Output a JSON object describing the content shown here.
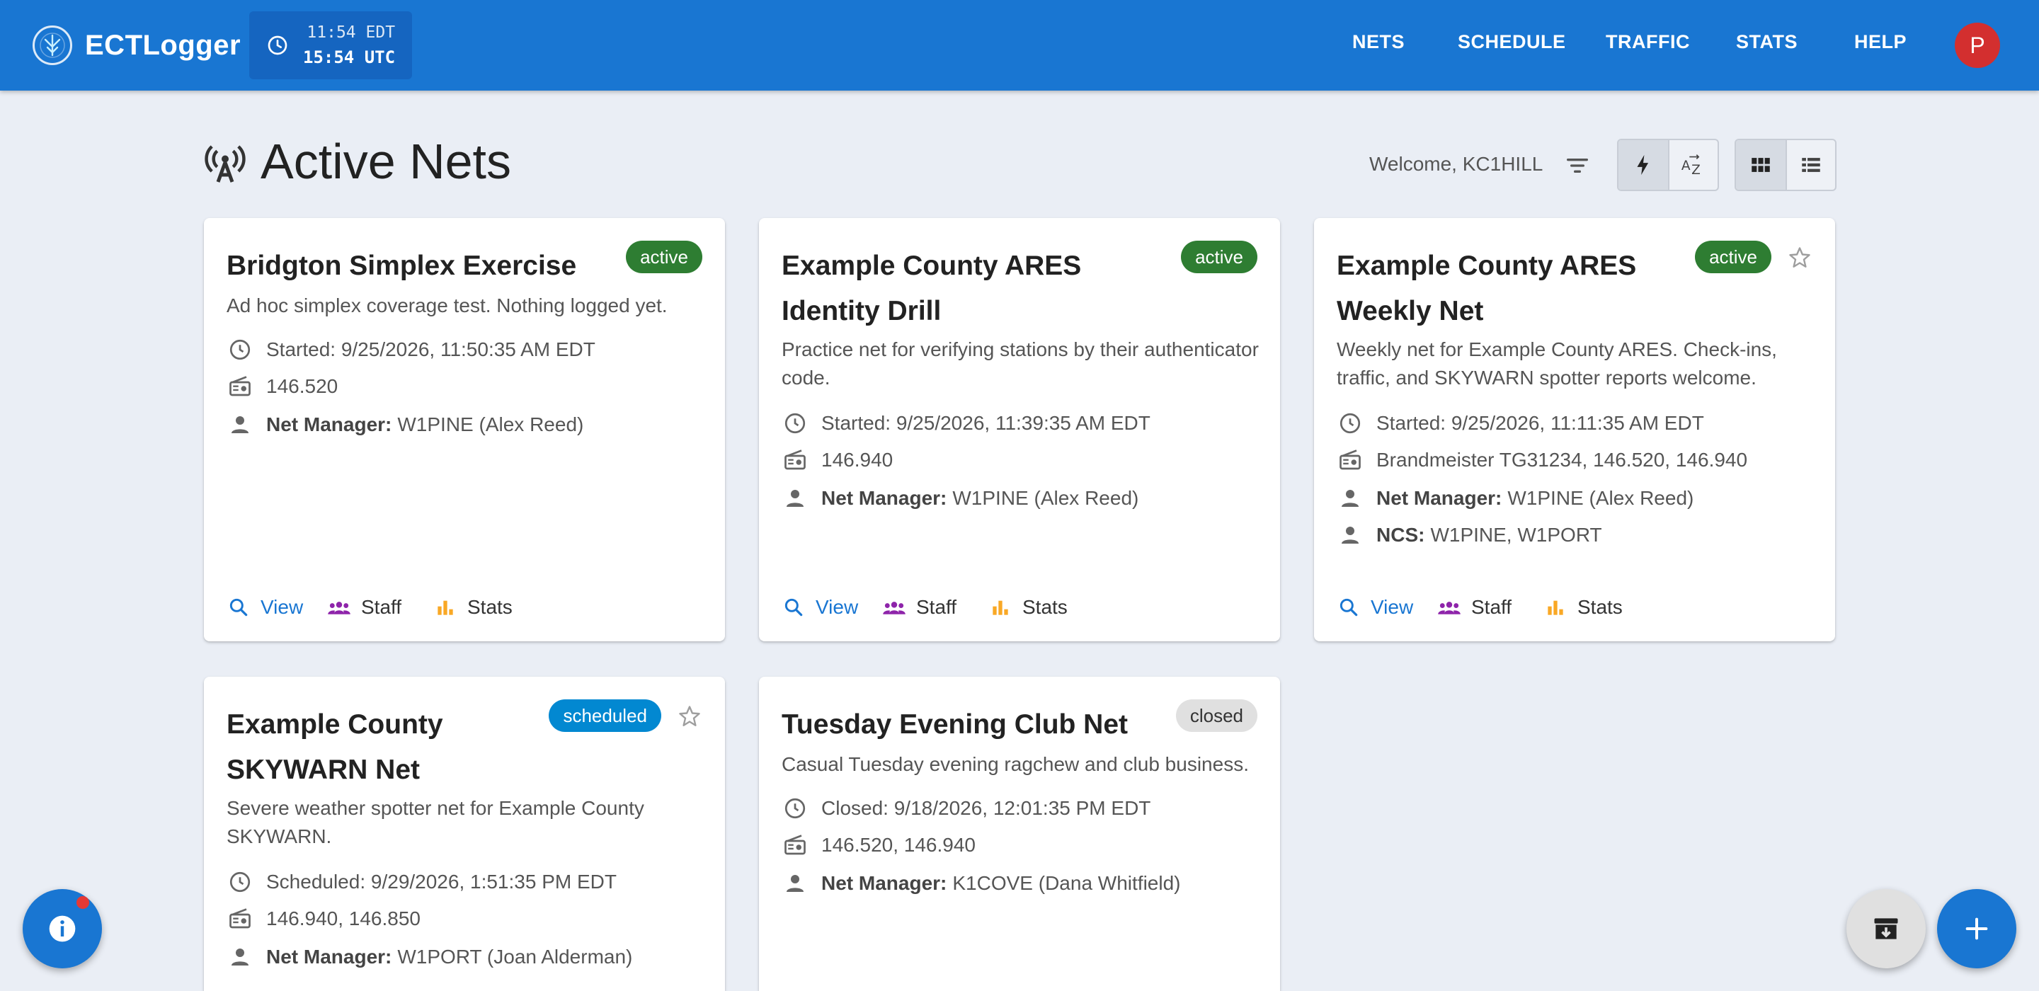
{
  "app": {
    "name": "ECTLogger",
    "clock_local": "11:54 EDT",
    "clock_utc": "15:54 UTC",
    "nav": [
      "NETS",
      "SCHEDULE",
      "TRAFFIC",
      "STATS",
      "HELP"
    ],
    "avatar_initial": "P",
    "accent": "#1976d2"
  },
  "page": {
    "title": "Active Nets",
    "welcome": "Welcome, KC1HILL",
    "sort_modes": [
      "lightning-icon",
      "sort-alpha-icon"
    ],
    "view_modes": [
      "grid-icon",
      "list-icon"
    ]
  },
  "labels": {
    "net_manager": "Net Manager:",
    "ncs": "NCS:",
    "view": "View",
    "staff": "Staff",
    "stats": "Stats"
  },
  "cards": [
    {
      "title": "Bridgton Simplex Exercise",
      "status": "active",
      "starred_visible": false,
      "description": "Ad hoc simplex coverage test. Nothing logged yet.",
      "time": "Started: 9/25/2026, 11:50:35 AM EDT",
      "frequency": "146.520",
      "net_manager": "W1PINE (Alex Reed)"
    },
    {
      "title": "Example County ARES Identity Drill",
      "status": "active",
      "starred_visible": false,
      "description": "Practice net for verifying stations by their authenticator code.",
      "time": "Started: 9/25/2026, 11:39:35 AM EDT",
      "frequency": "146.940",
      "net_manager": "W1PINE (Alex Reed)"
    },
    {
      "title": "Example County ARES Weekly Net",
      "status": "active",
      "starred_visible": true,
      "description": "Weekly net for Example County ARES. Check-ins, traffic, and SKYWARN spotter reports welcome.",
      "time": "Started: 9/25/2026, 11:11:35 AM EDT",
      "frequency": "Brandmeister TG31234, 146.520, 146.940",
      "net_manager": "W1PINE (Alex Reed)",
      "ncs": "W1PINE, W1PORT"
    },
    {
      "title": "Example County SKYWARN Net",
      "status": "scheduled",
      "starred_visible": true,
      "description": "Severe weather spotter net for Example County SKYWARN.",
      "time": "Scheduled: 9/29/2026, 1:51:35 PM EDT",
      "frequency": "146.940, 146.850",
      "net_manager": "W1PORT (Joan Alderman)"
    },
    {
      "title": "Tuesday Evening Club Net",
      "status": "closed",
      "starred_visible": false,
      "description": "Casual Tuesday evening ragchew and club business.",
      "time": "Closed: 9/18/2026, 12:01:35 PM EDT",
      "frequency": "146.520, 146.940",
      "net_manager": "K1COVE (Dana Whitfield)"
    }
  ],
  "colors": {
    "active": "#2e7d32",
    "scheduled": "#0288d1",
    "closed": "#e0e0e0",
    "staff_icon": "#8e24aa",
    "stats_icon": "#f9a825"
  }
}
